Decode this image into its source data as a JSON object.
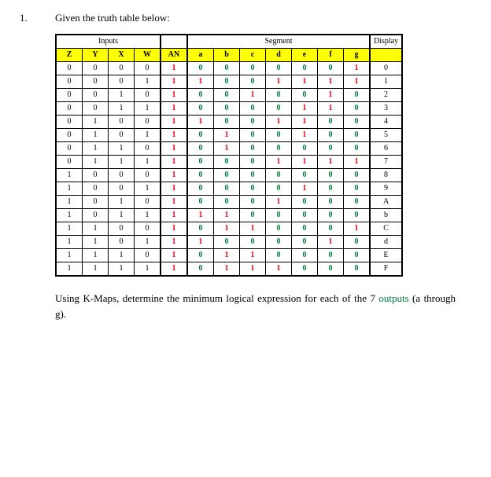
{
  "question_number": "1.",
  "question_text": "Given the truth table below:",
  "group_headers": [
    "Inputs",
    "",
    "Segment",
    "Display"
  ],
  "sub_headers": [
    "Z",
    "Y",
    "X",
    "W",
    "AN",
    "a",
    "b",
    "c",
    "d",
    "e",
    "f",
    "g",
    ""
  ],
  "chart_data": {
    "type": "table",
    "title": "Truth table for 7-segment display",
    "columns": [
      "Z",
      "Y",
      "X",
      "W",
      "AN",
      "a",
      "b",
      "c",
      "d",
      "e",
      "f",
      "g",
      "Display"
    ],
    "rows": [
      [
        "0",
        "0",
        "0",
        "0",
        "1",
        "0",
        "0",
        "0",
        "0",
        "0",
        "0",
        "1",
        "0"
      ],
      [
        "0",
        "0",
        "0",
        "1",
        "1",
        "1",
        "0",
        "0",
        "1",
        "1",
        "1",
        "1",
        "1"
      ],
      [
        "0",
        "0",
        "1",
        "0",
        "1",
        "0",
        "0",
        "1",
        "0",
        "0",
        "1",
        "0",
        "2"
      ],
      [
        "0",
        "0",
        "1",
        "1",
        "1",
        "0",
        "0",
        "0",
        "0",
        "1",
        "1",
        "0",
        "3"
      ],
      [
        "0",
        "1",
        "0",
        "0",
        "1",
        "1",
        "0",
        "0",
        "1",
        "1",
        "0",
        "0",
        "4"
      ],
      [
        "0",
        "1",
        "0",
        "1",
        "1",
        "0",
        "1",
        "0",
        "0",
        "1",
        "0",
        "0",
        "5"
      ],
      [
        "0",
        "1",
        "1",
        "0",
        "1",
        "0",
        "1",
        "0",
        "0",
        "0",
        "0",
        "0",
        "6"
      ],
      [
        "0",
        "1",
        "1",
        "1",
        "1",
        "0",
        "0",
        "0",
        "1",
        "1",
        "1",
        "1",
        "7"
      ],
      [
        "1",
        "0",
        "0",
        "0",
        "1",
        "0",
        "0",
        "0",
        "0",
        "0",
        "0",
        "0",
        "8"
      ],
      [
        "1",
        "0",
        "0",
        "1",
        "1",
        "0",
        "0",
        "0",
        "0",
        "1",
        "0",
        "0",
        "9"
      ],
      [
        "1",
        "0",
        "1",
        "0",
        "1",
        "0",
        "0",
        "0",
        "1",
        "0",
        "0",
        "0",
        "A"
      ],
      [
        "1",
        "0",
        "1",
        "1",
        "1",
        "1",
        "1",
        "0",
        "0",
        "0",
        "0",
        "0",
        "b"
      ],
      [
        "1",
        "1",
        "0",
        "0",
        "1",
        "0",
        "1",
        "1",
        "0",
        "0",
        "0",
        "1",
        "C"
      ],
      [
        "1",
        "1",
        "0",
        "1",
        "1",
        "1",
        "0",
        "0",
        "0",
        "0",
        "1",
        "0",
        "d"
      ],
      [
        "1",
        "1",
        "1",
        "0",
        "1",
        "0",
        "1",
        "1",
        "0",
        "0",
        "0",
        "0",
        "E"
      ],
      [
        "1",
        "1",
        "1",
        "1",
        "1",
        "0",
        "1",
        "1",
        "1",
        "0",
        "0",
        "0",
        "F"
      ]
    ]
  },
  "instruction_pre": "Using K-Maps, determine the minimum logical expression for each of the 7 ",
  "instruction_green": "outputs",
  "instruction_post": " (a through g)."
}
